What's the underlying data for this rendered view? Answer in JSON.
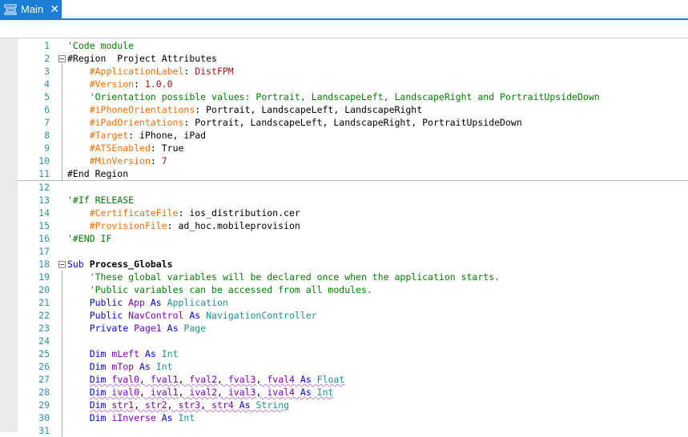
{
  "tab": {
    "label": "Main",
    "icon": "module-icon",
    "close": "✕"
  },
  "lines": [
    {
      "n": "1",
      "t": [
        [
          "c",
          "'Code module"
        ]
      ]
    },
    {
      "n": "2",
      "fold": true,
      "t": [
        [
          "p",
          "#Region  Project Attributes"
        ]
      ]
    },
    {
      "n": "3",
      "t": [
        [
          "p",
          "    "
        ],
        [
          "d",
          "#ApplicationLabel"
        ],
        [
          "p",
          ": "
        ],
        [
          "v",
          "DistFPM"
        ]
      ]
    },
    {
      "n": "4",
      "t": [
        [
          "p",
          "    "
        ],
        [
          "d",
          "#Version"
        ],
        [
          "p",
          ": "
        ],
        [
          "v",
          "1.0.0"
        ]
      ]
    },
    {
      "n": "5",
      "t": [
        [
          "p",
          "    "
        ],
        [
          "c",
          "'Orientation possible values: Portrait, LandscapeLeft, LandscapeRight and PortraitUpsideDown"
        ]
      ]
    },
    {
      "n": "6",
      "t": [
        [
          "p",
          "    "
        ],
        [
          "d",
          "#iPhoneOrientations"
        ],
        [
          "p",
          ": Portrait, LandscapeLeft, LandscapeRight"
        ]
      ]
    },
    {
      "n": "7",
      "t": [
        [
          "p",
          "    "
        ],
        [
          "d",
          "#iPadOrientations"
        ],
        [
          "p",
          ": Portrait, LandscapeLeft, LandscapeRight, PortraitUpsideDown"
        ]
      ]
    },
    {
      "n": "8",
      "t": [
        [
          "p",
          "    "
        ],
        [
          "d",
          "#Target"
        ],
        [
          "p",
          ": iPhone, iPad"
        ]
      ]
    },
    {
      "n": "9",
      "t": [
        [
          "p",
          "    "
        ],
        [
          "d",
          "#ATSEnabled"
        ],
        [
          "p",
          ": True"
        ]
      ]
    },
    {
      "n": "10",
      "t": [
        [
          "p",
          "    "
        ],
        [
          "d",
          "#MinVersion"
        ],
        [
          "p",
          ": "
        ],
        [
          "v",
          "7"
        ]
      ]
    },
    {
      "n": "11",
      "end": true,
      "t": [
        [
          "p",
          "#End Region"
        ]
      ]
    },
    {
      "n": "12",
      "t": []
    },
    {
      "n": "13",
      "t": [
        [
          "c",
          "'#If RELEASE"
        ]
      ]
    },
    {
      "n": "14",
      "t": [
        [
          "p",
          "    "
        ],
        [
          "d",
          "#CertificateFile"
        ],
        [
          "p",
          ": ios_distribution.cer"
        ]
      ]
    },
    {
      "n": "15",
      "t": [
        [
          "p",
          "    "
        ],
        [
          "d",
          "#ProvisionFile"
        ],
        [
          "p",
          ": ad_hoc.mobileprovision"
        ]
      ]
    },
    {
      "n": "16",
      "t": [
        [
          "c",
          "'#END IF"
        ]
      ]
    },
    {
      "n": "17",
      "t": []
    },
    {
      "n": "18",
      "fold": true,
      "t": [
        [
          "k",
          "Sub "
        ],
        [
          "b",
          "Process_Globals"
        ]
      ]
    },
    {
      "n": "19",
      "t": [
        [
          "p",
          "    "
        ],
        [
          "c",
          "'These global variables will be declared once when the application starts."
        ]
      ]
    },
    {
      "n": "20",
      "t": [
        [
          "p",
          "    "
        ],
        [
          "c",
          "'Public variables can be accessed from all modules."
        ]
      ]
    },
    {
      "n": "21",
      "t": [
        [
          "p",
          "    "
        ],
        [
          "k",
          "Public "
        ],
        [
          "i",
          "App "
        ],
        [
          "k",
          "As "
        ],
        [
          "t",
          "Application"
        ]
      ]
    },
    {
      "n": "22",
      "t": [
        [
          "p",
          "    "
        ],
        [
          "k",
          "Public "
        ],
        [
          "i",
          "NavControl "
        ],
        [
          "k",
          "As "
        ],
        [
          "t",
          "NavigationController"
        ]
      ]
    },
    {
      "n": "23",
      "t": [
        [
          "p",
          "    "
        ],
        [
          "k",
          "Private "
        ],
        [
          "i",
          "Page1 "
        ],
        [
          "k",
          "As "
        ],
        [
          "t",
          "Page"
        ]
      ]
    },
    {
      "n": "24",
      "t": []
    },
    {
      "n": "25",
      "t": [
        [
          "p",
          "    "
        ],
        [
          "k",
          "Dim "
        ],
        [
          "i",
          "mLeft "
        ],
        [
          "k",
          "As "
        ],
        [
          "t",
          "Int"
        ]
      ]
    },
    {
      "n": "26",
      "t": [
        [
          "p",
          "    "
        ],
        [
          "k",
          "Dim "
        ],
        [
          "i",
          "mTop "
        ],
        [
          "k",
          "As "
        ],
        [
          "t",
          "Int"
        ]
      ]
    },
    {
      "n": "27",
      "sq": true,
      "t": [
        [
          "p",
          "    "
        ],
        [
          "k",
          "Dim "
        ],
        [
          "i",
          "fval0"
        ],
        [
          "p",
          ", "
        ],
        [
          "i",
          "fval1"
        ],
        [
          "p",
          ", "
        ],
        [
          "i",
          "fval2"
        ],
        [
          "p",
          ", "
        ],
        [
          "i",
          "fval3"
        ],
        [
          "p",
          ", "
        ],
        [
          "i",
          "fval4 "
        ],
        [
          "k",
          "As "
        ],
        [
          "t",
          "Float"
        ]
      ]
    },
    {
      "n": "28",
      "sq": true,
      "t": [
        [
          "p",
          "    "
        ],
        [
          "k",
          "Dim "
        ],
        [
          "i",
          "ival0"
        ],
        [
          "p",
          ", "
        ],
        [
          "i",
          "ival1"
        ],
        [
          "p",
          ", "
        ],
        [
          "i",
          "ival2"
        ],
        [
          "p",
          ", "
        ],
        [
          "i",
          "ival3"
        ],
        [
          "p",
          ", "
        ],
        [
          "i",
          "ival4 "
        ],
        [
          "k",
          "As "
        ],
        [
          "t",
          "Int"
        ]
      ]
    },
    {
      "n": "29",
      "sq": true,
      "t": [
        [
          "p",
          "    "
        ],
        [
          "k",
          "Dim "
        ],
        [
          "i",
          "str1"
        ],
        [
          "p",
          ", "
        ],
        [
          "i",
          "str2"
        ],
        [
          "p",
          ", "
        ],
        [
          "i",
          "str3"
        ],
        [
          "p",
          ", "
        ],
        [
          "i",
          "str4 "
        ],
        [
          "k",
          "As "
        ],
        [
          "t",
          "String"
        ]
      ]
    },
    {
      "n": "30",
      "t": [
        [
          "p",
          "    "
        ],
        [
          "k",
          "Dim "
        ],
        [
          "i",
          "iInverse "
        ],
        [
          "k",
          "As "
        ],
        [
          "t",
          "Int"
        ]
      ]
    },
    {
      "n": "31",
      "t": []
    }
  ]
}
